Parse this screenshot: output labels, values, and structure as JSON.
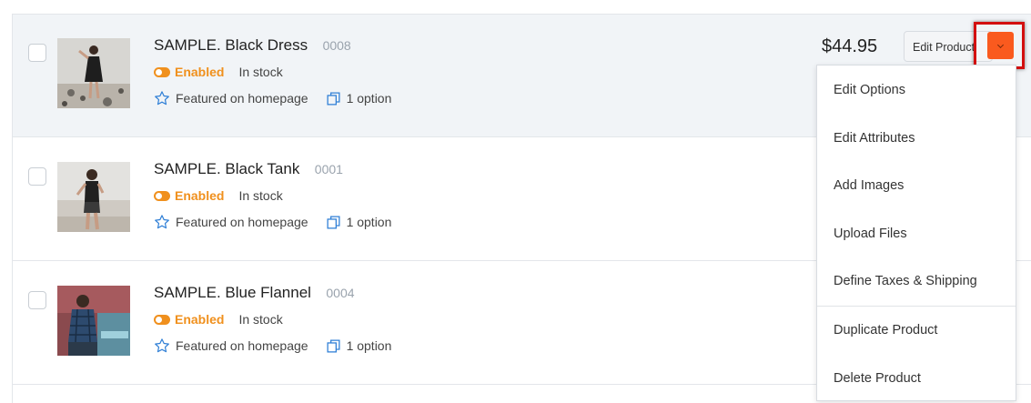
{
  "products": [
    {
      "title": "SAMPLE. Black Dress",
      "sku": "0008",
      "status": "Enabled",
      "stock": "In stock",
      "featured": "Featured on homepage",
      "options": "1 option",
      "price": "$44.95",
      "edit_label": "Edit Product",
      "selected": true
    },
    {
      "title": "SAMPLE. Black Tank",
      "sku": "0001",
      "status": "Enabled",
      "stock": "In stock",
      "featured": "Featured on homepage",
      "options": "1 option"
    },
    {
      "title": "SAMPLE. Blue Flannel",
      "sku": "0004",
      "status": "Enabled",
      "stock": "In stock",
      "featured": "Featured on homepage",
      "options": "1 option"
    }
  ],
  "dropdown_menu": {
    "items": [
      "Edit Options",
      "Edit Attributes",
      "Add Images",
      "Upload Files",
      "Define Taxes & Shipping"
    ],
    "secondary_items": [
      "Duplicate Product",
      "Delete Product"
    ]
  },
  "icons": {
    "status": "toggle-icon",
    "featured": "star-outline-icon",
    "options": "copy-icon",
    "dropdown": "chevron-down-icon"
  },
  "colors": {
    "accent": "#fa5a1e",
    "enabled": "#f0901d",
    "highlight": "#d30f0f",
    "icon_blue": "#2f7fd6",
    "selected_row": "#f1f4f7"
  }
}
